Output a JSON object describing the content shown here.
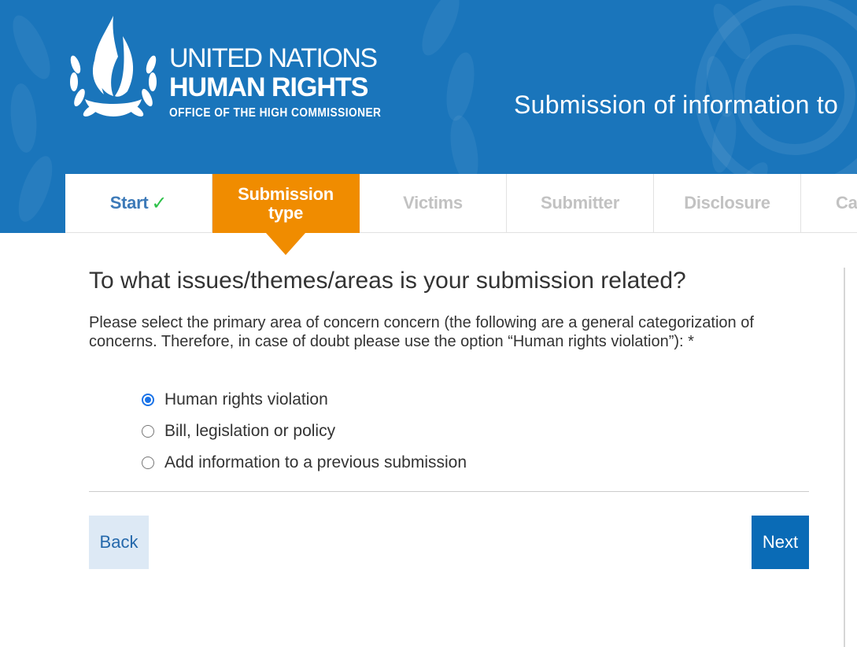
{
  "header": {
    "logo": {
      "line1": "UNITED NATIONS",
      "line2": "HUMAN RIGHTS",
      "line3": "OFFICE OF THE HIGH COMMISSIONER"
    },
    "title": "Submission of information to"
  },
  "steps": [
    {
      "label": "Start",
      "state": "done",
      "mark": "✓"
    },
    {
      "label_line1": "Submission",
      "label_line2": "type",
      "state": "active"
    },
    {
      "label": "Victims",
      "state": "pending"
    },
    {
      "label": "Submitter",
      "state": "pending"
    },
    {
      "label": "Disclosure",
      "state": "pending"
    },
    {
      "label": "Ca",
      "state": "pending"
    }
  ],
  "form": {
    "question": "To what issues/themes/areas is your submission related?",
    "instructions": "Please select the primary area of concern concern (the following are a general categorization of concerns. Therefore, in case of doubt please use the option “Human rights violation”): *",
    "options": [
      {
        "label": "Human rights violation",
        "checked": true
      },
      {
        "label": "Bill, legislation or policy",
        "checked": false
      },
      {
        "label": "Add information to a previous submission",
        "checked": false
      }
    ],
    "selected_index": 0
  },
  "buttons": {
    "back": "Back",
    "next": "Next"
  },
  "colors": {
    "header_bg": "#1a75bb",
    "active_step": "#f08c00",
    "done_step_text": "#3d7ab8",
    "check_mark": "#2ec24a",
    "next_button": "#0a6bb6",
    "back_button": "#dde9f5"
  },
  "icons": {
    "logo_emblem": "un-human-rights-flame-emblem",
    "done_mark": "check-icon"
  }
}
